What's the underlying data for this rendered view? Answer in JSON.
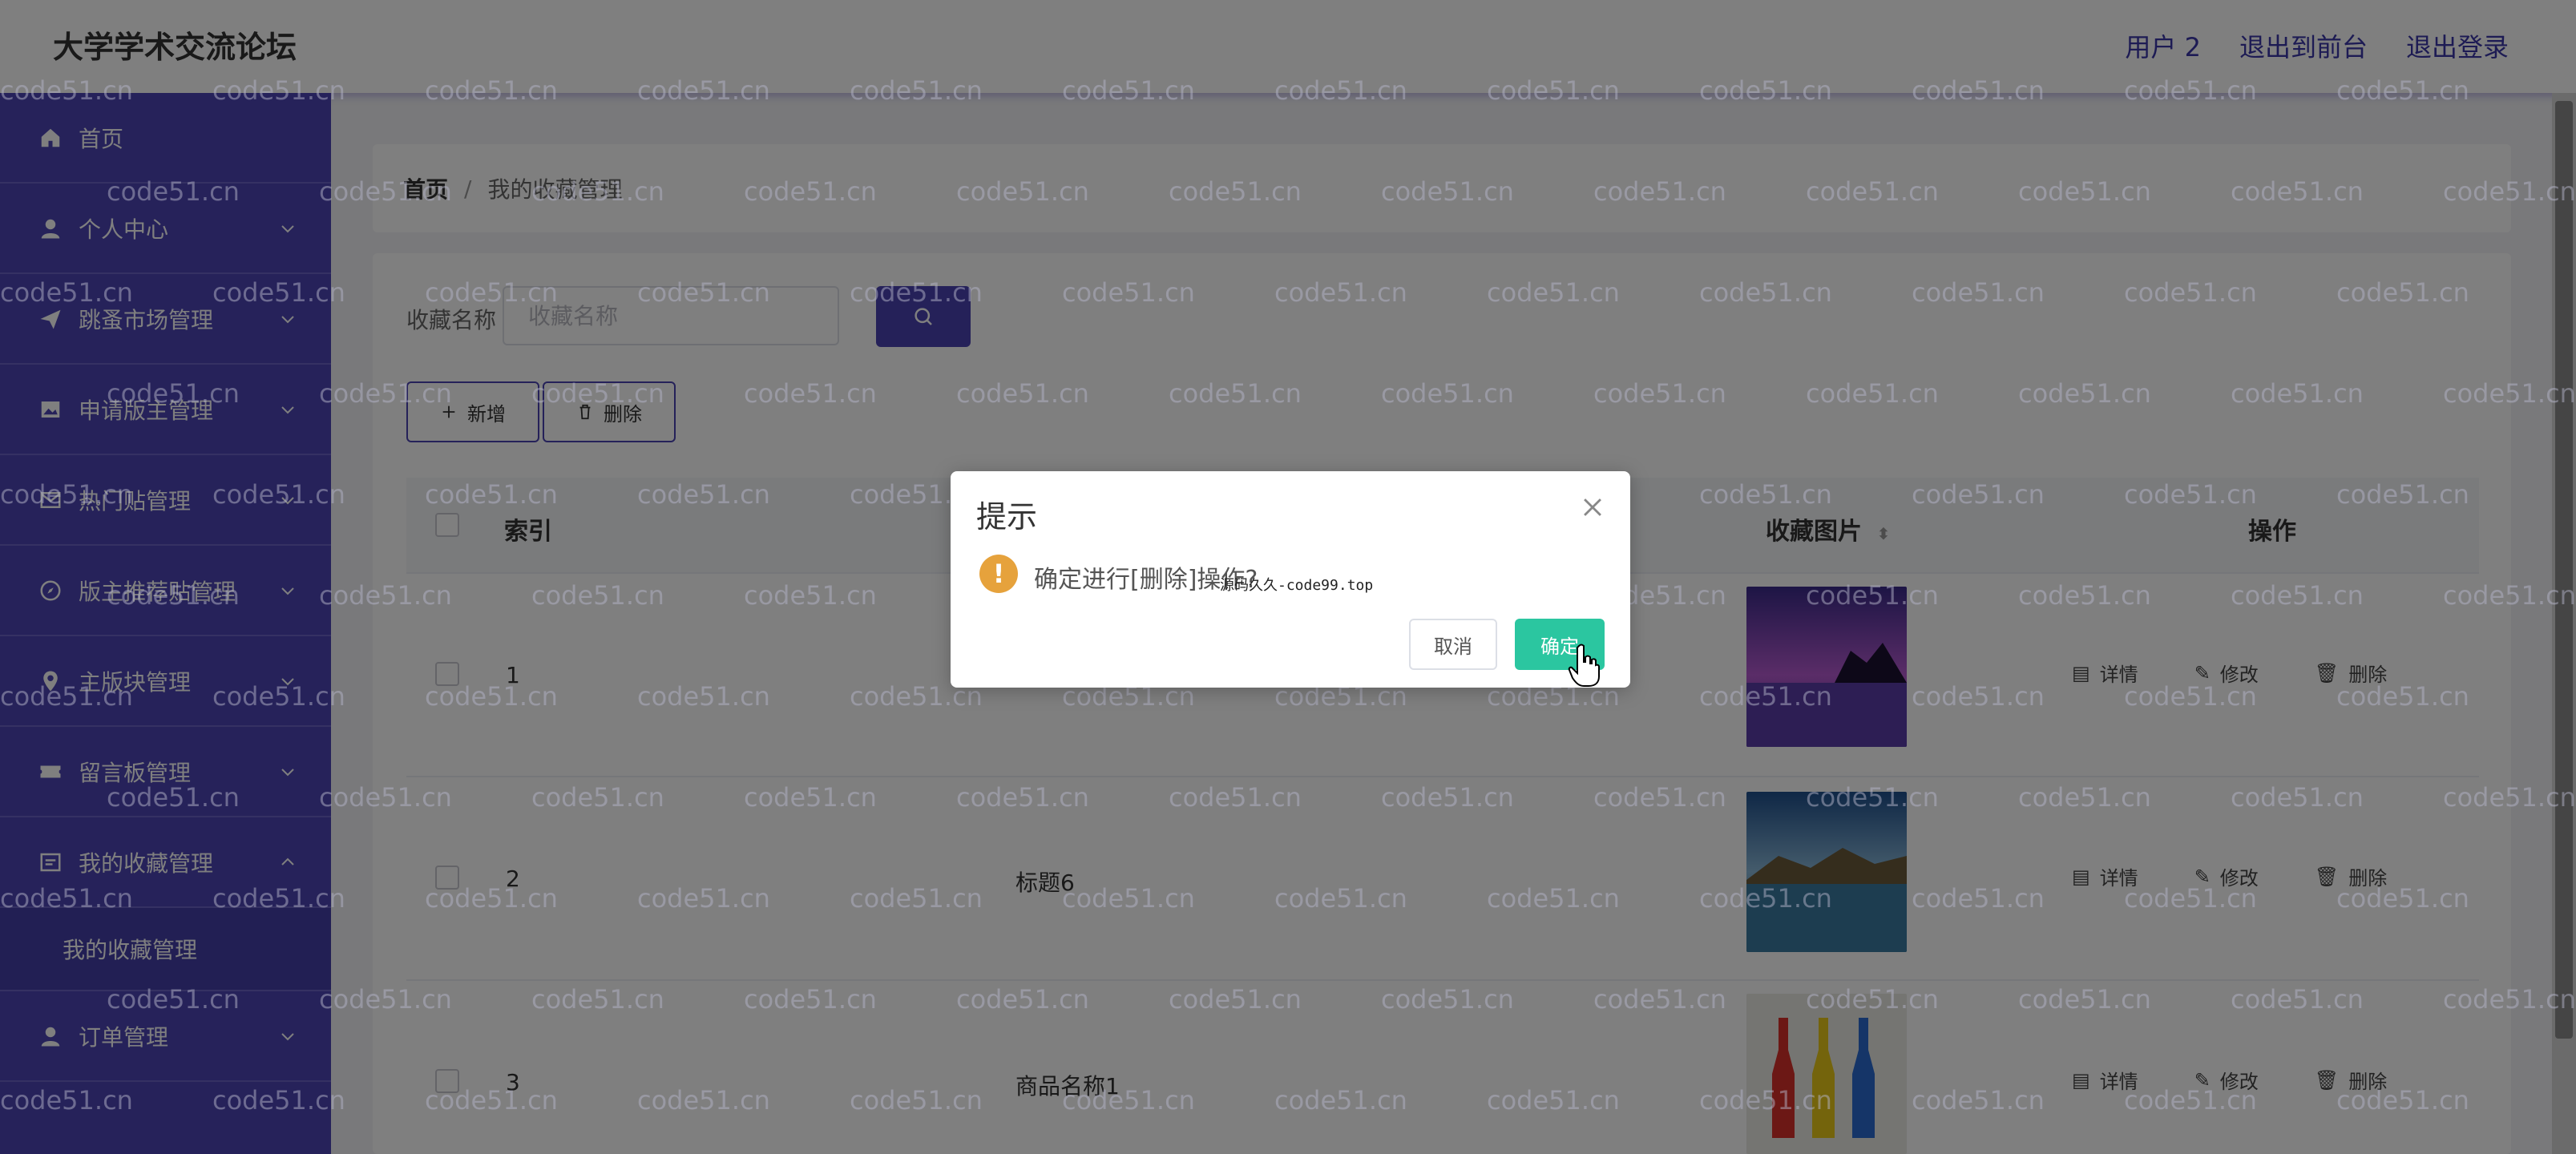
{
  "header": {
    "title": "大学学术交流论坛",
    "user": "用户 2",
    "to_front": "退出到前台",
    "logout": "退出登录"
  },
  "sidebar": {
    "items": [
      {
        "label": "首页",
        "icon": "home-icon"
      },
      {
        "label": "个人中心",
        "icon": "user-icon"
      },
      {
        "label": "跳蚤市场管理",
        "icon": "send-icon"
      },
      {
        "label": "申请版主管理",
        "icon": "picture-icon"
      },
      {
        "label": "热门贴管理",
        "icon": "message-icon"
      },
      {
        "label": "版主推荐贴管理",
        "icon": "compass-icon"
      },
      {
        "label": "主版块管理",
        "icon": "location-icon"
      },
      {
        "label": "留言板管理",
        "icon": "ticket-icon"
      },
      {
        "label": "我的收藏管理",
        "icon": "tablet-icon"
      },
      {
        "label": "订单管理",
        "icon": "user-icon"
      }
    ],
    "sub_item": "我的收藏管理"
  },
  "breadcrumb": {
    "home": "首页",
    "sep": "/",
    "current": "我的收藏管理"
  },
  "search": {
    "label": "收藏名称",
    "placeholder": "收藏名称"
  },
  "toolbar": {
    "add": "新增",
    "delete": "删除"
  },
  "table": {
    "headers": {
      "index": "索引",
      "image": "收藏图片",
      "action": "操作"
    },
    "rows": [
      {
        "index": "1",
        "name": ""
      },
      {
        "index": "2",
        "name": "标题6"
      },
      {
        "index": "3",
        "name": "商品名称1"
      }
    ],
    "actions": {
      "detail": "详情",
      "edit": "修改",
      "delete": "删除"
    }
  },
  "dialog": {
    "title": "提示",
    "message": "确定进行[删除]操作?",
    "stamp": "源码久久-code99.top",
    "cancel": "取消",
    "ok": "确定"
  },
  "watermark": "code51.cn",
  "colors": {
    "sidebar": "#4d45b5",
    "accent": "#4a43b3",
    "ok_button": "#2bc6a0",
    "warning": "#e6a23c"
  }
}
